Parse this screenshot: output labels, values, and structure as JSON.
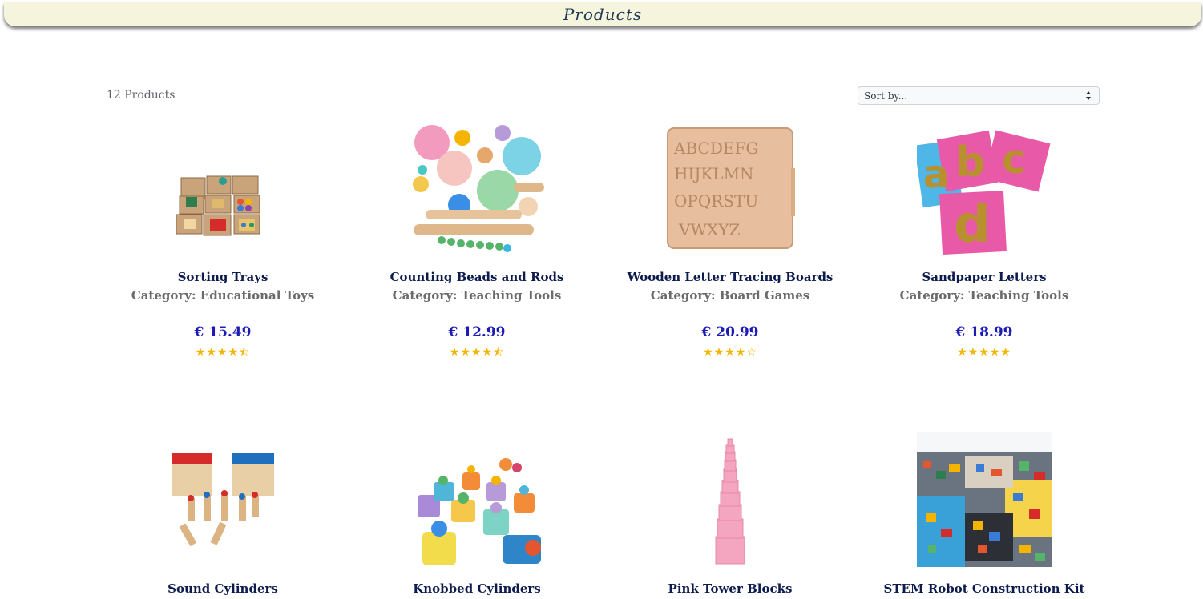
{
  "header": {
    "title": "Products"
  },
  "listing": {
    "count_label": "12 Products",
    "sort_placeholder": "Sort by..."
  },
  "products": [
    {
      "name": "Sorting Trays",
      "category": "Category: Educational Toys",
      "price": "€ 15.49",
      "rating": 4.5,
      "stars": "★★★★⯪"
    },
    {
      "name": "Counting Beads and Rods",
      "category": "Category: Teaching Tools",
      "price": "€ 12.99",
      "rating": 4.5,
      "stars": "★★★★⯪"
    },
    {
      "name": "Wooden Letter Tracing Boards",
      "category": "Category: Board Games",
      "price": "€ 20.99",
      "rating": 4,
      "stars": "★★★★☆"
    },
    {
      "name": "Sandpaper Letters",
      "category": "Category: Teaching Tools",
      "price": "€ 18.99",
      "rating": 5,
      "stars": "★★★★★"
    },
    {
      "name": "Sound Cylinders"
    },
    {
      "name": "Knobbed Cylinders"
    },
    {
      "name": "Pink Tower Blocks"
    },
    {
      "name": "STEM Robot Construction Kit"
    }
  ],
  "images": {
    "sandpaper_letters": [
      "a",
      "b",
      "c",
      "d"
    ],
    "tracing_board_rows": [
      "ABCDEFG",
      "HIJKLMN",
      "OPQRSTU",
      "VWXYZ"
    ]
  },
  "colors": {
    "header_bg": "#f5f4dd",
    "title": "#233a55",
    "product_name": "#0d1b4d",
    "price": "#1c1cb5",
    "star": "#f5b400"
  }
}
